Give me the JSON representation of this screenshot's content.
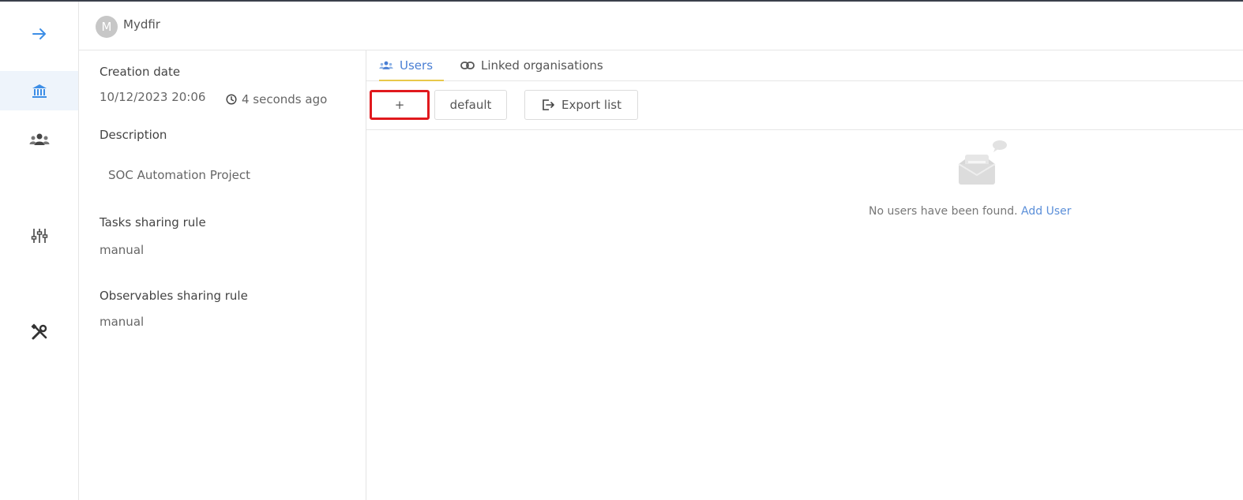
{
  "sidebar": {
    "items": [
      {
        "icon": "arrow-right-icon",
        "active": false
      },
      {
        "icon": "bank-icon",
        "active": true
      },
      {
        "icon": "users-icon",
        "active": false
      },
      {
        "icon": "sliders-icon",
        "active": false
      },
      {
        "icon": "tools-icon",
        "active": false
      }
    ]
  },
  "header": {
    "avatar_letter": "M",
    "org_name": "Mydfir"
  },
  "details": {
    "creation_date_label": "Creation date",
    "creation_date_value": "10/12/2023 20:06",
    "creation_relative": "4 seconds ago",
    "description_label": "Description",
    "description_value": "SOC Automation Project",
    "tasks_rule_label": "Tasks sharing rule",
    "tasks_rule_value": "manual",
    "observables_rule_label": "Observables sharing rule",
    "observables_rule_value": "manual"
  },
  "tabs": [
    {
      "label": "Users",
      "icon": "users-icon",
      "active": true
    },
    {
      "label": "Linked organisations",
      "icon": "link-icon",
      "active": false
    }
  ],
  "toolbar": {
    "add_label": "+",
    "default_label": "default",
    "export_label": "Export list"
  },
  "empty_state": {
    "message": "No users have been found.",
    "link": "Add User"
  },
  "colors": {
    "accent": "#4a7fd4",
    "tab_underline": "#e8c84a",
    "highlight_border": "#e0191d",
    "active_rail_bg": "#eef4fb"
  }
}
